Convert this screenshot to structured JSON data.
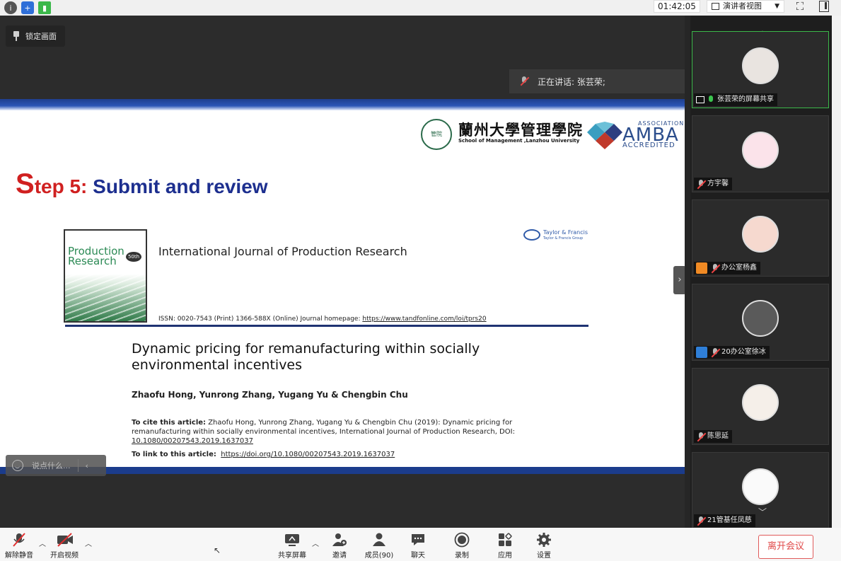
{
  "topbar": {
    "timer": "01:42:05",
    "view_mode": "演讲者视图",
    "icons": [
      "info-icon",
      "shield-icon",
      "signal-icon",
      "fullscreen-icon",
      "sidebar-icon"
    ]
  },
  "main": {
    "lock_label": "锁定画面",
    "speaking_label": "正在讲话: 张芸荣;",
    "chat_placeholder": "说点什么...",
    "collapse_glyph": "›"
  },
  "slide": {
    "uni_logo_text": "管院",
    "uni_name": "蘭州大學管理學院",
    "uni_sub": "School of Management ,Lanzhou University",
    "amba_association": "ASSOCIATION",
    "amba_main": "AMBA",
    "amba_accredited": "ACCREDITED",
    "step_s": "S",
    "step_rest": "tep 5: ",
    "step_title": "Submit and review",
    "cover_title": "Production Research",
    "cover_badge": "50th",
    "journal_title": "International Journal of Production Research",
    "publisher": "Taylor & Francis",
    "publisher_group": "Taylor & Francis Group",
    "issn_text": "ISSN: 0020-7543 (Print) 1366-588X (Online) Journal homepage: ",
    "homepage_url": "https://www.tandfonline.com/loi/tprs20",
    "article_title": "Dynamic pricing for remanufacturing within socially environmental incentives",
    "authors": "Zhaofu Hong, Yunrong Zhang, Yugang Yu & Chengbin Chu",
    "cite_label": "To cite this article:",
    "cite_text": " Zhaofu Hong, Yunrong Zhang, Yugang Yu & Chengbin Chu (2019): Dynamic pricing for remanufacturing within socially environmental incentives, International Journal of Production Research, DOI: ",
    "cite_doi": "10.1080/00207543.2019.1637037",
    "link_label": "To link to this article:",
    "link_url": "https://doi.org/10.1080/00207543.2019.1637037"
  },
  "participants": [
    {
      "name": "张芸荣的屏幕共享",
      "status": "mic-on",
      "active": true
    },
    {
      "name": "方宇馨",
      "status": "mic-off",
      "active": false
    },
    {
      "name": "办公室杨鑫",
      "status": "mic-off",
      "active": false
    },
    {
      "name": "20办公室徐冰",
      "status": "mic-off",
      "active": false
    },
    {
      "name": "陈思延",
      "status": "mic-off",
      "active": false
    },
    {
      "name": "21管基任凤慈",
      "status": "mic-off",
      "active": false
    }
  ],
  "toolbar": {
    "unmute": "解除静音",
    "start_video": "开启视频",
    "share_screen": "共享屏幕",
    "invite": "邀请",
    "members": "成员(90)",
    "chat": "聊天",
    "record": "录制",
    "apps": "应用",
    "settings": "设置",
    "leave": "离开会议"
  },
  "colors": {
    "active_border": "#3bb84a",
    "slide_blue": "#1d2f8f",
    "slide_red": "#d02020",
    "leave_red": "#e04848"
  }
}
